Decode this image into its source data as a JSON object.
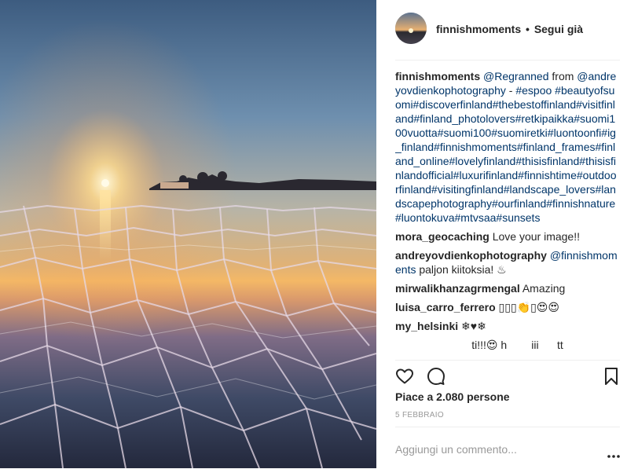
{
  "post": {
    "username": "finnishmoments",
    "separator": "•",
    "follow_status": "Segui già"
  },
  "comments": [
    {
      "user": "finnishmoments",
      "parts": [
        {
          "t": "@Regranned",
          "link": true
        },
        {
          "t": " from ",
          "link": false
        },
        {
          "t": "@andreyovdienkophotography",
          "link": true
        },
        {
          "t": " - ",
          "link": false
        },
        {
          "t": "#espoo #beautyofsuomi#discoverfinland#thebestoffinland#visitfinland#finland_photolovers#retkipaikka#suomi100vuotta#suomi100#suomiretki#luontoonfi#ig_finland#finnishmoments#finland_frames#finland_online#lovelyfinland#thisisfinland#thisisfinlandofficial#luxurifinland#finnishtime#outdoorfinland#visitingfinland#landscape_lovers#landscapephotography#ourfinland#finnishnature#luontokuva#mtvsaa#sunsets",
          "link": true
        }
      ]
    },
    {
      "user": "mora_geocaching",
      "parts": [
        {
          "t": " Love your image!!",
          "link": false
        }
      ]
    },
    {
      "user": "andreyovdienkophotography",
      "parts": [
        {
          "t": " ",
          "link": false
        },
        {
          "t": "@finnishmoments",
          "link": true
        },
        {
          "t": " paljon kiitoksia! ♨",
          "link": false
        }
      ]
    },
    {
      "user": "mirwalikhanzagrmengal",
      "parts": [
        {
          "t": " Amazing",
          "link": false
        }
      ]
    },
    {
      "user": "luisa_carro_ferrero",
      "parts": [
        {
          "t": " ▯▯▯👏▯😍😍",
          "link": false
        }
      ]
    },
    {
      "user": "my_helsinki",
      "parts": [
        {
          "t": " ❄♥❄",
          "link": false
        }
      ]
    },
    {
      "user": "",
      "parts": [
        {
          "t": "                         ti!!!😍 h        iii      tt",
          "link": false
        }
      ]
    }
  ],
  "actions": {
    "like_icon": "heart-icon",
    "comment_icon": "comment-icon",
    "save_icon": "bookmark-icon"
  },
  "likes_text": "Piace a 2.080 persone",
  "date_text": "5 febbraio",
  "comment_box": {
    "placeholder": "Aggiungi un commento...",
    "more_icon": "more-options-icon"
  }
}
